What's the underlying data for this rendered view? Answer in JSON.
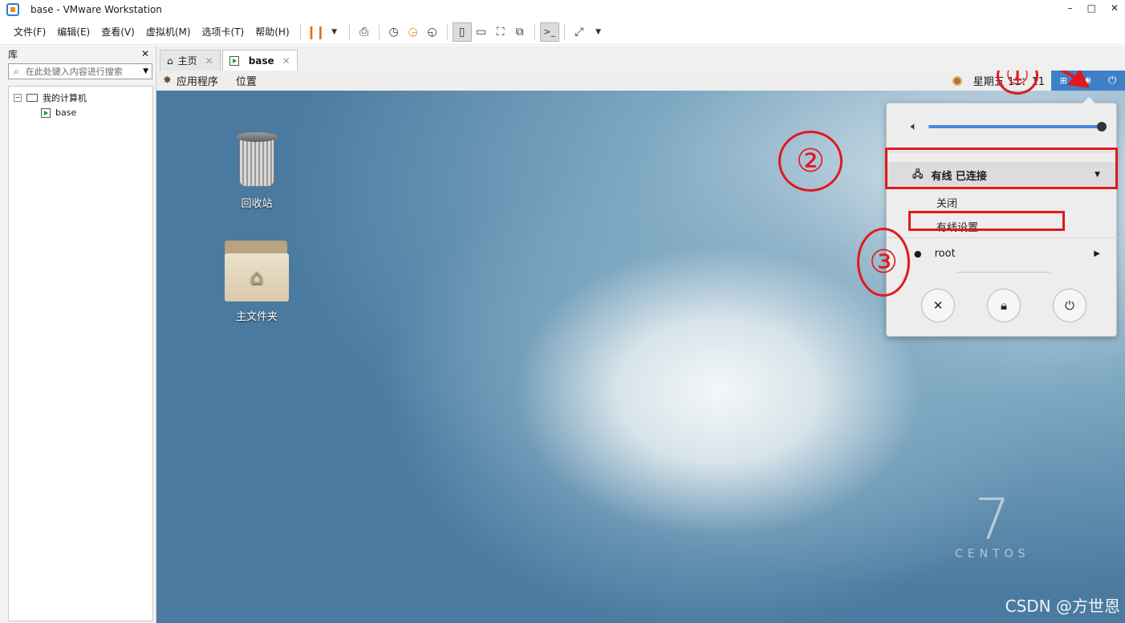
{
  "window": {
    "title": "base - VMware Workstation",
    "controls": [
      "–",
      "□",
      "✕"
    ]
  },
  "menubar": {
    "items": [
      "文件(F)",
      "编辑(E)",
      "查看(V)",
      "虚拟机(M)",
      "选项卡(T)",
      "帮助(H)"
    ]
  },
  "library": {
    "title": "库",
    "close": "✕",
    "search_placeholder": "在此处键入内容进行搜索",
    "tree": {
      "root": "我的计算机",
      "child": "base"
    }
  },
  "tabs": [
    {
      "label": "主页",
      "close": "✕"
    },
    {
      "label": "base",
      "close": "✕"
    }
  ],
  "guest": {
    "topbar": {
      "apps": "应用程序",
      "places": "位置",
      "clock": "星期五 11：11"
    },
    "desktop_icons": [
      {
        "label": "回收站",
        "icon": "trash-icon"
      },
      {
        "label": "主文件夹",
        "icon": "home-folder-icon"
      }
    ],
    "popup": {
      "wired": "有线  已连接",
      "off": "关闭",
      "settings": "有线设置",
      "user": "root",
      "volume_level": 1.0,
      "buttons": [
        "settings-icon",
        "lock-icon",
        "power-icon"
      ]
    },
    "branding": {
      "number": "7",
      "word": "CENTOS"
    }
  },
  "annotations": {
    "one": "①",
    "two": "②",
    "three": "③"
  },
  "watermark": "CSDN @方世恩",
  "colors": {
    "accent": "#3f7fc8",
    "annotation": "#e0191e",
    "pause": "#e86f0e"
  }
}
